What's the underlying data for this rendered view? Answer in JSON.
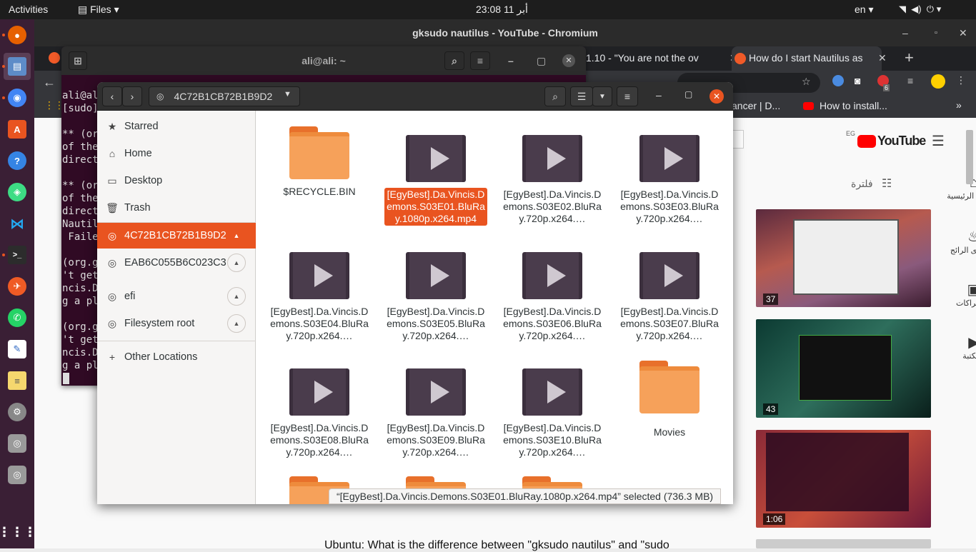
{
  "topbar": {
    "activities": "Activities",
    "app_menu": "Files",
    "clock": "23:08  أبر 11",
    "lang": "en"
  },
  "dock": {
    "apps": [
      "firefox-icon",
      "files-icon",
      "chromium-icon",
      "software-icon",
      "help-icon",
      "android-icon",
      "vscode-icon",
      "terminal-icon",
      "postman-icon",
      "whatsapp-icon",
      "editor-icon",
      "notes-icon",
      "settings-icon",
      "drive-icon",
      "drive-icon-2",
      "apps-grid-icon"
    ]
  },
  "chrome": {
    "window_title": "gksudo nautilus - YouTube - Chromium",
    "tabs": [
      {
        "label": "1.10 - \"You are not the ov"
      },
      {
        "label": "How do I start Nautilus as"
      }
    ],
    "bookmarks": [
      {
        "label": "ancer | D..."
      },
      {
        "label": "How to install..."
      }
    ],
    "bookmarks_more": "»",
    "extension_badge": "6"
  },
  "youtube": {
    "region": "EG",
    "logo": "YouTube",
    "filter": "فلترة",
    "nav": [
      {
        "label": "الصفحة الرئيسية"
      },
      {
        "label": "المحتوى الرائج"
      },
      {
        "label": "الاشتراكات"
      },
      {
        "label": "المكتبة"
      }
    ],
    "durations": [
      "37",
      "43",
      "1:06"
    ],
    "video_title": "Ubuntu: What is the difference between \"gksudo nautilus\" and \"sudo"
  },
  "terminal": {
    "title": "ali@ali: ~",
    "lines": "ali@ali\n[sudo]\n\n** (or\nof the\ndirect\n\n** (or\nof the\ndirect\nNautil\n Faile\n\n(org.g\n't get\nncis.D\ng a pl\n\n(org.g\n't get\nncis.D\ng a pl"
  },
  "nautilus": {
    "path": "4C72B1CB72B1B9D2",
    "sidebar": [
      {
        "label": "Starred",
        "icon": "star-icon"
      },
      {
        "label": "Home",
        "icon": "home-icon"
      },
      {
        "label": "Desktop",
        "icon": "desktop-icon"
      },
      {
        "label": "Trash",
        "icon": "trash-icon"
      },
      {
        "label": "4C72B1CB72B1B9D2",
        "icon": "drive-icon"
      },
      {
        "label": "EAB6C055B6C023C3",
        "icon": "drive-icon"
      },
      {
        "label": "efi",
        "icon": "drive-icon"
      },
      {
        "label": "Filesystem root",
        "icon": "drive-icon"
      },
      {
        "label": "Other Locations",
        "icon": "plus-icon"
      }
    ],
    "files": [
      {
        "name": "$RECYCLE.BIN",
        "type": "folder"
      },
      {
        "name": "[EgyBest].Da.Vincis.Demons.S03E01.BluRay.1080p.x264.mp4",
        "type": "video"
      },
      {
        "name": "[EgyBest].Da.Vincis.Demons.S03E02.BluRay.720p.x264.…",
        "type": "video"
      },
      {
        "name": "[EgyBest].Da.Vincis.Demons.S03E03.BluRay.720p.x264.…",
        "type": "video"
      },
      {
        "name": "[EgyBest].Da.Vincis.Demons.S03E04.BluRay.720p.x264.…",
        "type": "video"
      },
      {
        "name": "[EgyBest].Da.Vincis.Demons.S03E05.BluRay.720p.x264.…",
        "type": "video"
      },
      {
        "name": "[EgyBest].Da.Vincis.Demons.S03E06.BluRay.720p.x264.…",
        "type": "video"
      },
      {
        "name": "[EgyBest].Da.Vincis.Demons.S03E07.BluRay.720p.x264.…",
        "type": "video"
      },
      {
        "name": "[EgyBest].Da.Vincis.Demons.S03E08.BluRay.720p.x264.…",
        "type": "video"
      },
      {
        "name": "[EgyBest].Da.Vincis.Demons.S03E09.BluRay.720p.x264.…",
        "type": "video"
      },
      {
        "name": "[EgyBest].Da.Vincis.Demons.S03E10.BluRay.720p.x264.…",
        "type": "video"
      },
      {
        "name": "Movies",
        "type": "folder"
      }
    ],
    "status": "“[EgyBest].Da.Vincis.Demons.S03E01.BluRay.1080p.x264.mp4” selected  (736.3 MB)"
  }
}
